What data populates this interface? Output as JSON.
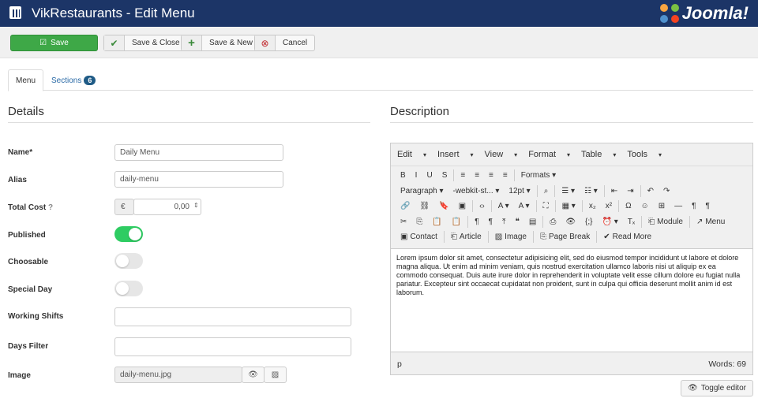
{
  "header": {
    "title": "VikRestaurants - Edit Menu",
    "logo": "Joomla!",
    "bg": "#1c3567"
  },
  "toolbar": {
    "save": "Save",
    "save_close": "Save & Close",
    "save_new": "Save & New",
    "cancel": "Cancel"
  },
  "tabs": [
    {
      "label": "Menu"
    },
    {
      "label": "Sections",
      "count": "6"
    }
  ],
  "details": {
    "heading": "Details",
    "fields": {
      "name": {
        "label": "Name*",
        "value": "Daily Menu"
      },
      "alias": {
        "label": "Alias",
        "value": "daily-menu"
      },
      "total_cost": {
        "label": "Total Cost",
        "currency": "€",
        "value": "0,00"
      },
      "published": {
        "label": "Published",
        "on": true
      },
      "choosable": {
        "label": "Choosable",
        "on": false
      },
      "special_day": {
        "label": "Special Day",
        "on": false
      },
      "working_shifts": {
        "label": "Working Shifts",
        "value": ""
      },
      "days_filter": {
        "label": "Days Filter",
        "value": ""
      },
      "image": {
        "label": "Image",
        "value": "daily-menu.jpg"
      }
    }
  },
  "description": {
    "heading": "Description",
    "menus": [
      "Edit",
      "Insert",
      "View",
      "Format",
      "Table",
      "Tools"
    ],
    "rows": [
      [
        {
          "icon": "bold",
          "g": "B"
        },
        {
          "icon": "italic",
          "g": "I"
        },
        {
          "icon": "underline",
          "g": "U"
        },
        {
          "icon": "strikethrough",
          "g": "S"
        },
        "|",
        {
          "icon": "align-left",
          "g": "≡"
        },
        {
          "icon": "align-center",
          "g": "≡"
        },
        {
          "icon": "align-right",
          "g": "≡"
        },
        {
          "icon": "align-justify",
          "g": "≡"
        },
        "|",
        {
          "label": "Formats ▾"
        }
      ],
      [
        {
          "label": "Paragraph  ▾"
        },
        {
          "label": "-webkit-st... ▾"
        },
        {
          "label": "12pt            ▾"
        },
        "|",
        {
          "icon": "find",
          "g": "⌕"
        },
        "|",
        {
          "icon": "bullet-list",
          "g": "☰ ▾"
        },
        {
          "icon": "numbered-list",
          "g": "☷ ▾"
        },
        "|",
        {
          "icon": "outdent",
          "g": "⇤"
        },
        {
          "icon": "indent",
          "g": "⇥"
        },
        "|",
        {
          "icon": "undo",
          "g": "↶"
        },
        {
          "icon": "redo",
          "g": "↷"
        }
      ],
      [
        {
          "icon": "link",
          "g": "🔗"
        },
        {
          "icon": "unlink",
          "g": "⛓"
        },
        {
          "icon": "bookmark",
          "g": "🔖"
        },
        {
          "icon": "image",
          "g": "▣"
        },
        "|",
        {
          "icon": "code",
          "g": "‹›"
        },
        "|",
        {
          "icon": "text-color",
          "g": "A ▾"
        },
        {
          "icon": "background-color",
          "g": "A ▾"
        },
        "|",
        {
          "icon": "fullscreen",
          "g": "⛶"
        },
        "|",
        {
          "icon": "table",
          "g": "▦ ▾"
        },
        "|",
        {
          "icon": "subscript",
          "g": "x₂"
        },
        {
          "icon": "superscript",
          "g": "x²"
        },
        "|",
        {
          "icon": "special-char",
          "g": "Ω"
        },
        {
          "icon": "emoticons",
          "g": "☺"
        },
        {
          "icon": "media",
          "g": "⊞"
        },
        {
          "icon": "hr",
          "g": "—"
        },
        {
          "icon": "ltr",
          "g": "¶"
        },
        {
          "icon": "rtl",
          "g": "¶"
        }
      ],
      [
        {
          "icon": "cut",
          "g": "✂"
        },
        {
          "icon": "copy",
          "g": "⎘"
        },
        {
          "icon": "paste",
          "g": "📋"
        },
        {
          "icon": "paste-text",
          "g": "📋"
        },
        "|",
        {
          "icon": "visual-chars",
          "g": "¶"
        },
        {
          "icon": "visual-blocks",
          "g": "¶"
        },
        {
          "icon": "upload",
          "g": "⤒"
        },
        {
          "icon": "blockquote",
          "g": "❝"
        },
        {
          "icon": "template",
          "g": "▤"
        },
        "|",
        {
          "icon": "print",
          "g": "⎙"
        },
        {
          "icon": "preview",
          "g": "👁"
        },
        {
          "icon": "code-sample",
          "g": "{;}"
        },
        {
          "icon": "insert-time",
          "g": "⏰ ▾"
        },
        {
          "icon": "clear-format",
          "g": "Tₓ"
        },
        "|",
        {
          "icon": "module",
          "g": "⎗",
          "label": "Module"
        },
        "|",
        {
          "icon": "menu",
          "g": "↗",
          "label": "Menu"
        }
      ],
      [
        {
          "icon": "contact",
          "g": "▣",
          "label": "Contact"
        },
        "|",
        {
          "icon": "article",
          "g": "⎗",
          "label": "Article"
        },
        "|",
        {
          "icon": "image",
          "g": "▨",
          "label": "Image"
        },
        "|",
        {
          "icon": "page-break",
          "g": "⎘",
          "label": "Page Break"
        },
        "|",
        {
          "icon": "read-more",
          "g": "✔",
          "label": "Read More"
        }
      ]
    ],
    "body": "Lorem ipsum dolor sit amet, consectetur adipisicing elit, sed do eiusmod tempor incididunt ut labore et dolore magna aliqua. Ut enim ad minim veniam, quis nostrud exercitation ullamco laboris nisi ut aliquip ex ea commodo consequat. Duis aute irure dolor in reprehenderit in voluptate velit esse cillum dolore eu fugiat nulla pariatur. Excepteur sint occaecat cupidatat non proident, sunt in culpa qui officia deserunt mollit anim id est laborum.",
    "path": "p",
    "words": "Words: 69",
    "toggle": "Toggle editor"
  }
}
